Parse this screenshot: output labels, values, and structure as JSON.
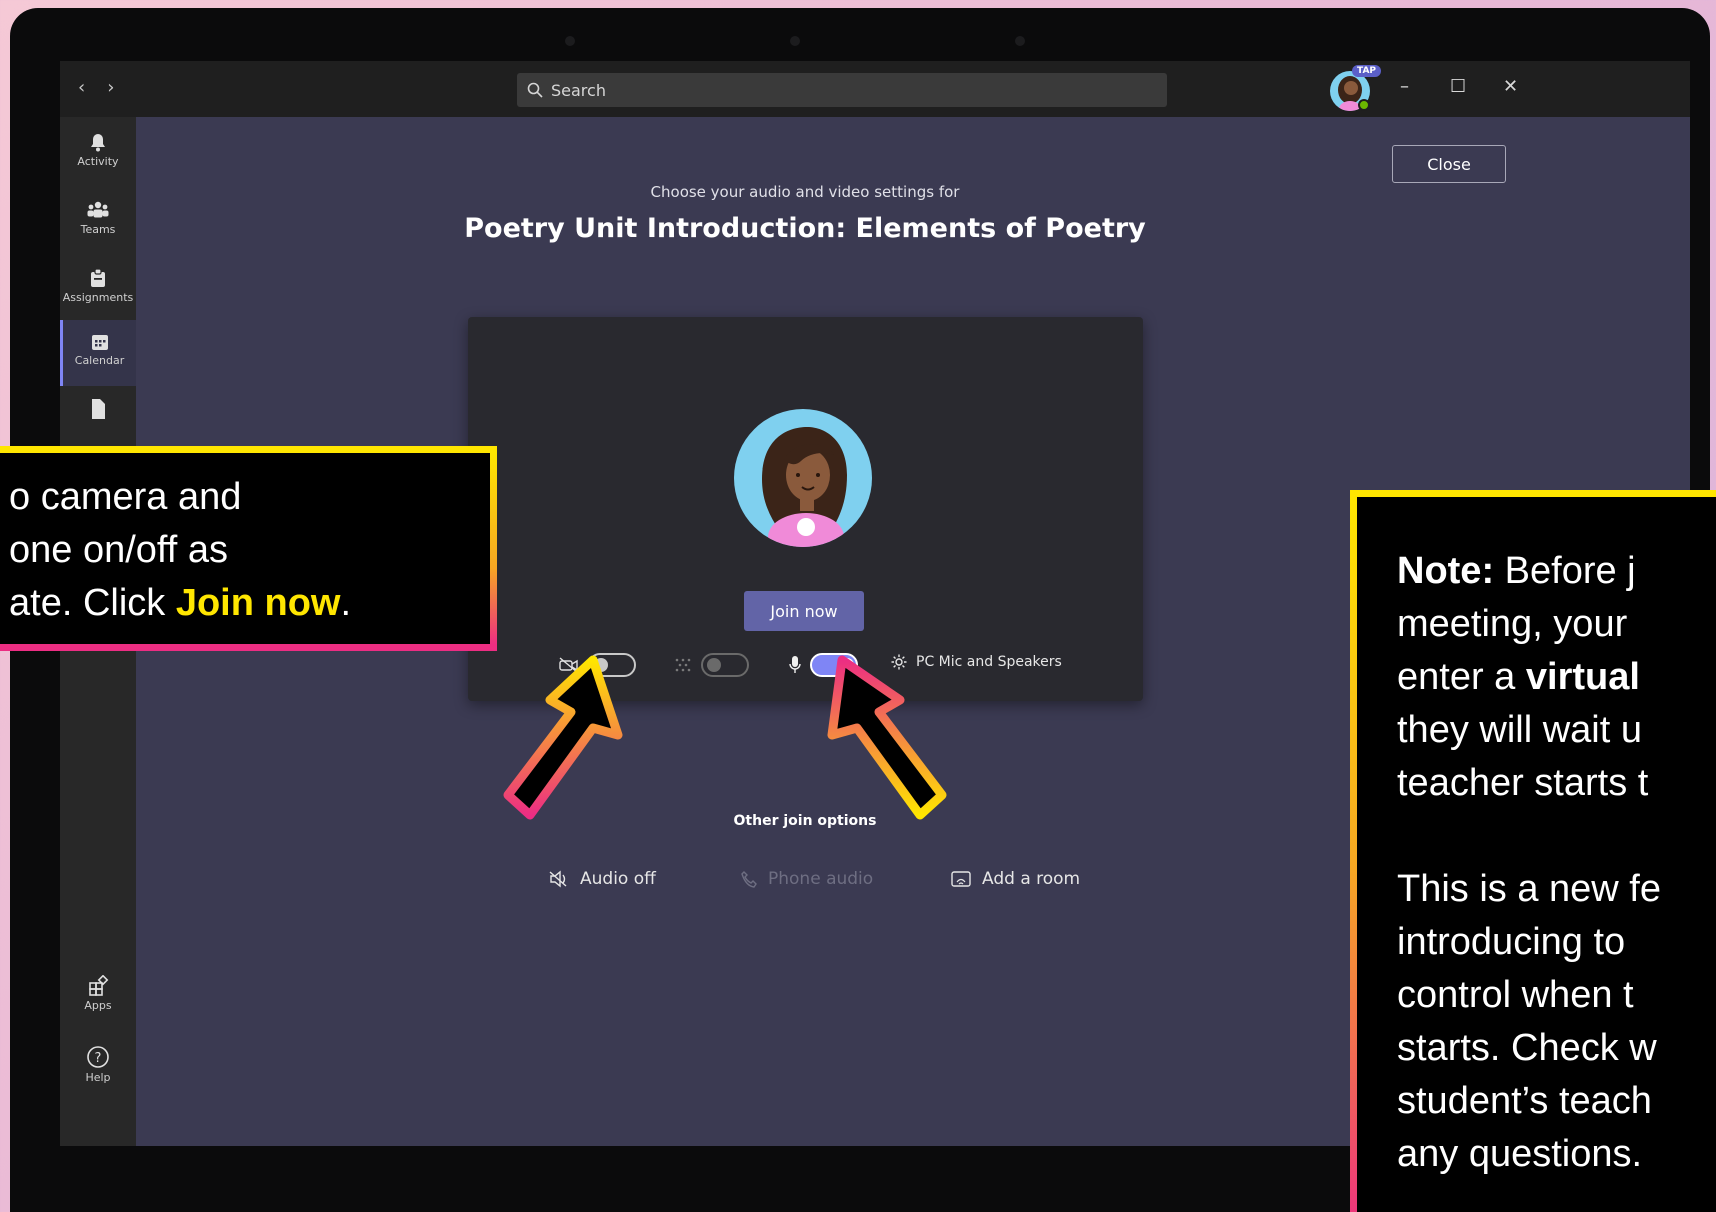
{
  "window": {
    "search_placeholder": "Search",
    "tap_badge": "TAP",
    "minimize_glyph": "–",
    "maximize_glyph": "☐",
    "close_glyph": "✕"
  },
  "rail": {
    "items": [
      {
        "label": "Activity",
        "icon": "bell-icon"
      },
      {
        "label": "Teams",
        "icon": "teams-icon"
      },
      {
        "label": "Assignments",
        "icon": "assignments-icon"
      },
      {
        "label": "Calendar",
        "icon": "calendar-icon",
        "active": true
      },
      {
        "label": "Apps",
        "icon": "apps-icon"
      },
      {
        "label": "Help",
        "icon": "help-icon"
      }
    ]
  },
  "prejoin": {
    "close_label": "Close",
    "subtitle": "Choose your audio and video settings for",
    "meeting_title": "Poetry Unit Introduction: Elements of Poetry",
    "join_label": "Join now",
    "camera_toggle": "off",
    "blur_toggle": "off",
    "mic_toggle": "on",
    "device_label": "PC Mic and Speakers",
    "other_title": "Other join options",
    "options": [
      "Audio off",
      "Phone audio",
      "Add a room"
    ]
  },
  "callouts": {
    "left": {
      "line1": "o camera and",
      "line2": "one on/off as",
      "line3_prefix": "ate. Click ",
      "line3_bold": "Join now",
      "line3_suffix": "."
    },
    "right": {
      "note_label": "Note:",
      "line1_rest": " Before j",
      "line2": "meeting, your",
      "line3_prefix": "enter a ",
      "line3_bold": "virtual",
      "line4": "they will wait u",
      "line5": "teacher starts t",
      "line6": "This is a new fe",
      "line7": "introducing to",
      "line8": "control when t",
      "line9": "starts. Check w",
      "line10": "student’s teach",
      "line11": "any questions."
    }
  },
  "colors": {
    "accent": "#6264a7",
    "toggle_on": "#7f85f5",
    "highlight": "#ffe600"
  }
}
